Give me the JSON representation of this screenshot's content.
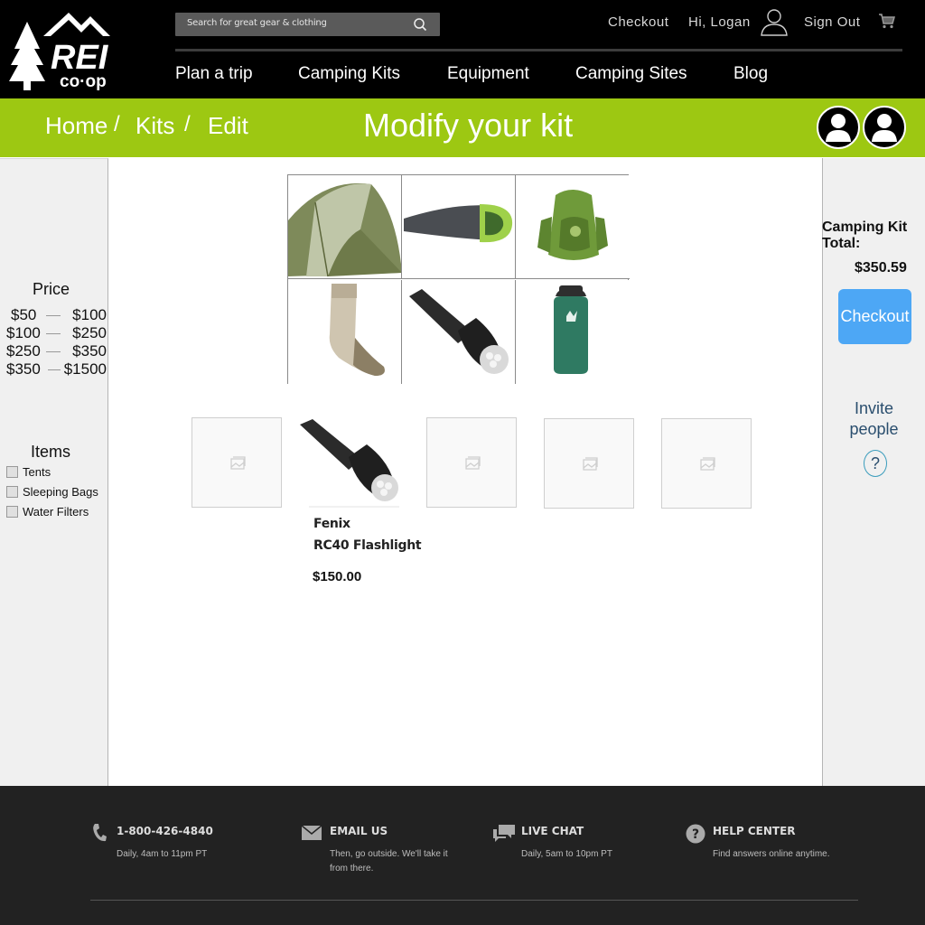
{
  "header": {
    "brand_main": "REI",
    "brand_sub": "co·op",
    "search_placeholder": "Search for great gear & clothing",
    "checkout_link": "Checkout",
    "greeting": "Hi, Logan",
    "sign_out": "Sign Out",
    "nav": [
      "Plan a trip",
      "Camping Kits",
      "Equipment",
      "Camping Sites",
      "Blog"
    ]
  },
  "breadcrumb": {
    "items": [
      "Home",
      "Kits",
      "Edit"
    ],
    "separator": "/"
  },
  "page_title": "Modify your kit",
  "filters": {
    "price_heading": "Price",
    "price_ranges": [
      {
        "low": "$50",
        "high": "$100"
      },
      {
        "low": "$100",
        "high": "$250"
      },
      {
        "low": "$250",
        "high": "$350"
      },
      {
        "low": "$350",
        "high": "$1500"
      }
    ],
    "items_heading": "Items",
    "items": [
      "Tents",
      "Sleeping Bags",
      "Water Filters"
    ]
  },
  "kit_grid": {
    "products": [
      "tent",
      "sleeping-bag",
      "backpack",
      "socks",
      "flashlight",
      "water-bottle"
    ]
  },
  "selected_product": {
    "brand": "Fenix",
    "name": "RC40 Flashlight",
    "price": "$150.00"
  },
  "summary": {
    "total_label": "Camping Kit Total:",
    "total_value": "$350.59",
    "checkout_button": "Checkout",
    "invite_label": "Invite people",
    "help_symbol": "?"
  },
  "footer": {
    "contacts": [
      {
        "icon": "phone-icon",
        "title": "1-800-426-4840",
        "sub": "Daily, 4am to 11pm PT"
      },
      {
        "icon": "mail-icon",
        "title": "EMAIL US",
        "sub": "Then, go outside. We'll take it from there."
      },
      {
        "icon": "chat-icon",
        "title": "LIVE CHAT",
        "sub": "Daily, 5am to 10pm PT"
      },
      {
        "icon": "help-icon",
        "title": "HELP CENTER",
        "sub": "Find answers online anytime."
      }
    ]
  },
  "colors": {
    "accent_green": "#9dc812",
    "checkout_blue": "#4da7f5",
    "header_bg": "#000000",
    "footer_bg": "#222222"
  }
}
